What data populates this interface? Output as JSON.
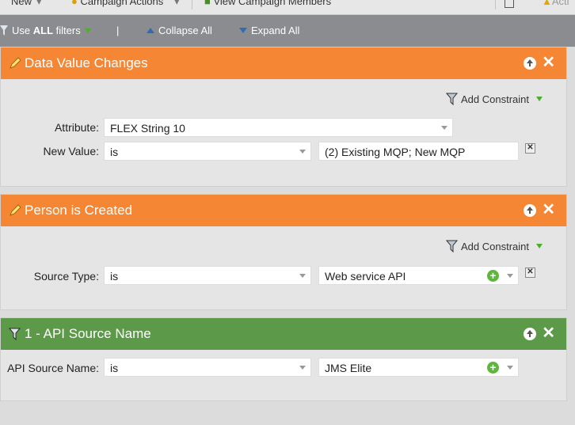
{
  "toolbar": {
    "new_label": "New",
    "campaign_actions_label": "Campaign Actions",
    "view_members_label": "View Campaign Members",
    "activity_label": "Acti"
  },
  "filterbar": {
    "use_prefix": "Use",
    "use_strong": "ALL",
    "use_suffix": "filters",
    "divider": "|",
    "collapse_label": "Collapse All",
    "expand_label": "Expand All"
  },
  "panels": [
    {
      "title": "Data Value Changes",
      "color": "#f58634",
      "add_constraint": "Add Constraint",
      "rows": [
        {
          "label": "Attribute:",
          "value": "FLEX String 10"
        },
        {
          "label": "New Value:",
          "operator": "is",
          "value": "(2) Existing MQP; New MQP"
        }
      ]
    },
    {
      "title": "Person is Created",
      "color": "#f58634",
      "add_constraint": "Add Constraint",
      "rows": [
        {
          "label": "Source Type:",
          "operator": "is",
          "value": "Web service API"
        }
      ]
    },
    {
      "title": "1 - API Source Name",
      "color": "#5c9a4a",
      "rows": [
        {
          "label": "API Source Name:",
          "operator": "is",
          "value": "JMS Elite"
        }
      ]
    }
  ],
  "icons": {
    "trigger": "lightning-pencil-icon",
    "filter": "funnel-icon",
    "move_up": "arrow-up-circle-icon",
    "close": "close-icon",
    "add": "plus-circle-icon",
    "delete": "delete-box-icon"
  }
}
